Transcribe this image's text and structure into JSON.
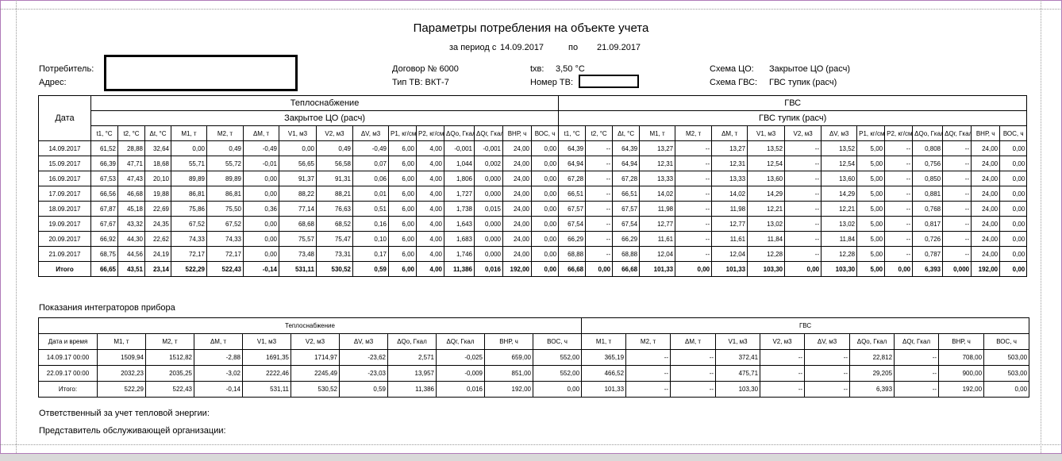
{
  "title": "Параметры потребления на объекте учета",
  "period": {
    "label": "за период с",
    "from": "14.09.2017",
    "to_label": "по",
    "to": "21.09.2017"
  },
  "consumer_label": "Потребитель:",
  "address_label": "Адрес:",
  "contract": "Договор №  6000",
  "tv_type": "Тип ТВ:  ВКТ-7",
  "txv_label": "tхв:",
  "txv_value": "3,50  °С",
  "tv_number_label": "Номер ТВ:",
  "scheme_co_label": "Схема ЦО:",
  "scheme_co_value": "Закрытое ЦО (расч)",
  "scheme_gvs_label": "Схема ГВС:",
  "scheme_gvs_value": "ГВС тупик (расч)",
  "table1": {
    "date_header": "Дата",
    "group1": "Теплоснабжение",
    "group1_sub": "Закрытое ЦО (расч)",
    "group2": "ГВС",
    "group2_sub": "ГВС тупик (расч)",
    "columns": [
      "t1, °C",
      "t2, °C",
      "Δt, °C",
      "M1, т",
      "M2, т",
      "ΔM, т",
      "V1, м3",
      "V2, м3",
      "ΔV, м3",
      "P1, кг/см2",
      "P2, кг/см2",
      "ΔQo, Гкал",
      "ΔQг, Гкал",
      "ВНР, ч",
      "ВОС, ч",
      "t1, °C",
      "t2, °C",
      "Δt, °C",
      "M1, т",
      "M2, т",
      "ΔM, т",
      "V1, м3",
      "V2, м3",
      "ΔV, м3",
      "P1, кг/см2",
      "P2, кг/см2",
      "ΔQo, Гкал",
      "ΔQг, Гкал",
      "ВНР, ч",
      "ВОС, ч"
    ],
    "rows": [
      [
        "14.09.2017",
        "61,52",
        "28,88",
        "32,64",
        "0,00",
        "0,49",
        "-0,49",
        "0,00",
        "0,49",
        "-0,49",
        "6,00",
        "4,00",
        "-0,001",
        "-0,001",
        "24,00",
        "0,00",
        "64,39",
        "--",
        "64,39",
        "13,27",
        "--",
        "13,27",
        "13,52",
        "--",
        "13,52",
        "5,00",
        "--",
        "0,808",
        "--",
        "24,00",
        "0,00"
      ],
      [
        "15.09.2017",
        "66,39",
        "47,71",
        "18,68",
        "55,71",
        "55,72",
        "-0,01",
        "56,65",
        "56,58",
        "0,07",
        "6,00",
        "4,00",
        "1,044",
        "0,002",
        "24,00",
        "0,00",
        "64,94",
        "--",
        "64,94",
        "12,31",
        "--",
        "12,31",
        "12,54",
        "--",
        "12,54",
        "5,00",
        "--",
        "0,756",
        "--",
        "24,00",
        "0,00"
      ],
      [
        "16.09.2017",
        "67,53",
        "47,43",
        "20,10",
        "89,89",
        "89,89",
        "0,00",
        "91,37",
        "91,31",
        "0,06",
        "6,00",
        "4,00",
        "1,806",
        "0,000",
        "24,00",
        "0,00",
        "67,28",
        "--",
        "67,28",
        "13,33",
        "--",
        "13,33",
        "13,60",
        "--",
        "13,60",
        "5,00",
        "--",
        "0,850",
        "--",
        "24,00",
        "0,00"
      ],
      [
        "17.09.2017",
        "66,56",
        "46,68",
        "19,88",
        "86,81",
        "86,81",
        "0,00",
        "88,22",
        "88,21",
        "0,01",
        "6,00",
        "4,00",
        "1,727",
        "0,000",
        "24,00",
        "0,00",
        "66,51",
        "--",
        "66,51",
        "14,02",
        "--",
        "14,02",
        "14,29",
        "--",
        "14,29",
        "5,00",
        "--",
        "0,881",
        "--",
        "24,00",
        "0,00"
      ],
      [
        "18.09.2017",
        "67,87",
        "45,18",
        "22,69",
        "75,86",
        "75,50",
        "0,36",
        "77,14",
        "76,63",
        "0,51",
        "6,00",
        "4,00",
        "1,738",
        "0,015",
        "24,00",
        "0,00",
        "67,57",
        "--",
        "67,57",
        "11,98",
        "--",
        "11,98",
        "12,21",
        "--",
        "12,21",
        "5,00",
        "--",
        "0,768",
        "--",
        "24,00",
        "0,00"
      ],
      [
        "19.09.2017",
        "67,67",
        "43,32",
        "24,35",
        "67,52",
        "67,52",
        "0,00",
        "68,68",
        "68,52",
        "0,16",
        "6,00",
        "4,00",
        "1,643",
        "0,000",
        "24,00",
        "0,00",
        "67,54",
        "--",
        "67,54",
        "12,77",
        "--",
        "12,77",
        "13,02",
        "--",
        "13,02",
        "5,00",
        "--",
        "0,817",
        "--",
        "24,00",
        "0,00"
      ],
      [
        "20.09.2017",
        "66,92",
        "44,30",
        "22,62",
        "74,33",
        "74,33",
        "0,00",
        "75,57",
        "75,47",
        "0,10",
        "6,00",
        "4,00",
        "1,683",
        "0,000",
        "24,00",
        "0,00",
        "66,29",
        "--",
        "66,29",
        "11,61",
        "--",
        "11,61",
        "11,84",
        "--",
        "11,84",
        "5,00",
        "--",
        "0,726",
        "--",
        "24,00",
        "0,00"
      ],
      [
        "21.09.2017",
        "68,75",
        "44,56",
        "24,19",
        "72,17",
        "72,17",
        "0,00",
        "73,48",
        "73,31",
        "0,17",
        "6,00",
        "4,00",
        "1,746",
        "0,000",
        "24,00",
        "0,00",
        "68,88",
        "--",
        "68,88",
        "12,04",
        "--",
        "12,04",
        "12,28",
        "--",
        "12,28",
        "5,00",
        "--",
        "0,787",
        "--",
        "24,00",
        "0,00"
      ]
    ],
    "total": [
      "Итого",
      "66,65",
      "43,51",
      "23,14",
      "522,29",
      "522,43",
      "-0,14",
      "531,11",
      "530,52",
      "0,59",
      "6,00",
      "4,00",
      "11,386",
      "0,016",
      "192,00",
      "0,00",
      "66,68",
      "0,00",
      "66,68",
      "101,33",
      "0,00",
      "101,33",
      "103,30",
      "0,00",
      "103,30",
      "5,00",
      "0,00",
      "6,393",
      "0,000",
      "192,00",
      "0,00"
    ]
  },
  "integrators_title": "Показания интеграторов прибора",
  "table2": {
    "group1": "Теплоснабжение",
    "group2": "ГВС",
    "columns": [
      "Дата и время",
      "M1, т",
      "M2, т",
      "ΔM, т",
      "V1, м3",
      "V2, м3",
      "ΔV, м3",
      "ΔQo, Гкал",
      "ΔQг, Гкал",
      "ВНР, ч",
      "ВОС, ч",
      "M1, т",
      "M2, т",
      "ΔM, т",
      "V1, м3",
      "V2, м3",
      "ΔV, м3",
      "ΔQo, Гкал",
      "ΔQг, Гкал",
      "ВНР, ч",
      "ВОС, ч"
    ],
    "rows": [
      [
        "14.09.17  00:00",
        "1509,94",
        "1512,82",
        "-2,88",
        "1691,35",
        "1714,97",
        "-23,62",
        "2,571",
        "-0,025",
        "659,00",
        "552,00",
        "365,19",
        "--",
        "--",
        "372,41",
        "--",
        "--",
        "22,812",
        "--",
        "708,00",
        "503,00"
      ],
      [
        "22.09.17  00:00",
        "2032,23",
        "2035,25",
        "-3,02",
        "2222,46",
        "2245,49",
        "-23,03",
        "13,957",
        "-0,009",
        "851,00",
        "552,00",
        "466,52",
        "--",
        "--",
        "475,71",
        "--",
        "--",
        "29,205",
        "--",
        "900,00",
        "503,00"
      ],
      [
        "Итого:",
        "522,29",
        "522,43",
        "-0,14",
        "531,11",
        "530,52",
        "0,59",
        "11,386",
        "0,016",
        "192,00",
        "0,00",
        "101,33",
        "--",
        "--",
        "103,30",
        "--",
        "--",
        "6,393",
        "--",
        "192,00",
        "0,00"
      ]
    ]
  },
  "responsible_label": "Ответственный за учет тепловой энергии:",
  "representative_label": "Представитель обслуживающей организации:"
}
